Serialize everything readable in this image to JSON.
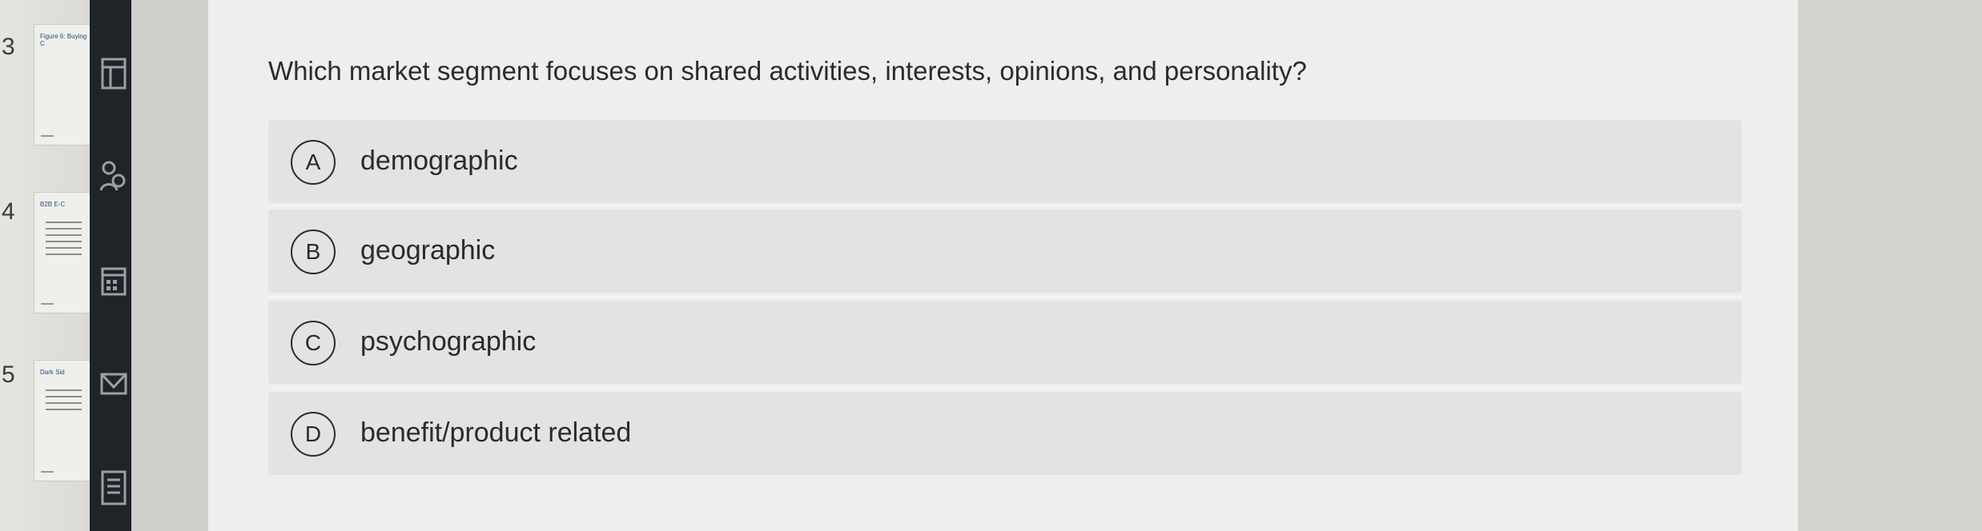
{
  "thumbnails": [
    {
      "number": "3",
      "title": "Figure 6: Buying C"
    },
    {
      "number": "4",
      "title": "B2B E-C"
    },
    {
      "number": "5",
      "title": "Dark Sid"
    }
  ],
  "toolbar": {
    "icons": [
      "slide-icon",
      "people-icon",
      "calendar-icon",
      "mail-icon",
      "document-icon"
    ]
  },
  "quiz": {
    "question": "Which market segment focuses on shared activities, interests, opinions, and personality?",
    "options": [
      {
        "letter": "A",
        "text": "demographic"
      },
      {
        "letter": "B",
        "text": "geographic"
      },
      {
        "letter": "C",
        "text": "psychographic"
      },
      {
        "letter": "D",
        "text": "benefit/product related"
      }
    ]
  }
}
